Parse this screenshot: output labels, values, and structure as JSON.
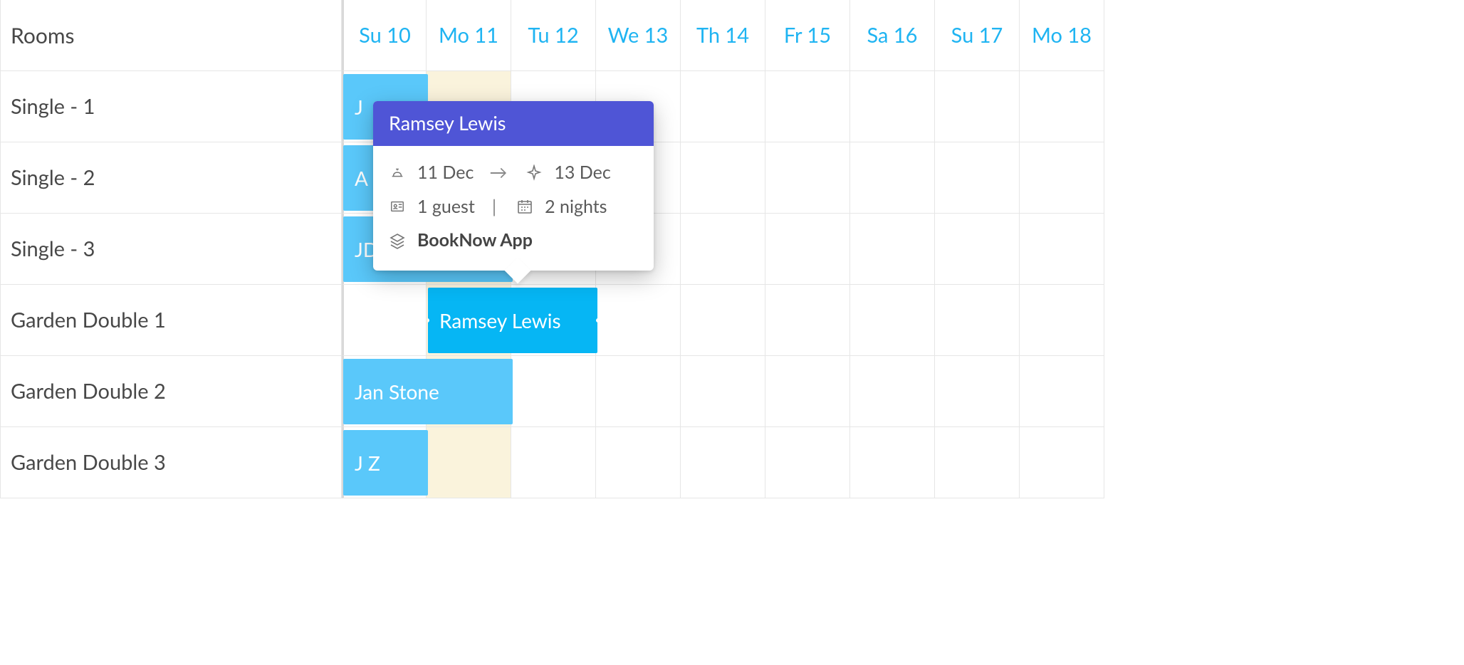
{
  "header": {
    "rooms_label": "Rooms",
    "dates": [
      "Su 10",
      "Mo 11",
      "Tu 12",
      "We 13",
      "Th 14",
      "Fr 15",
      "Sa 16",
      "Su 17",
      "Mo 18"
    ]
  },
  "rooms": [
    "Single - 1",
    "Single - 2",
    "Single - 3",
    "Garden Double 1",
    "Garden Double 2",
    "Garden Double 3"
  ],
  "today_column_index": 1,
  "bookings": [
    {
      "row": 0,
      "label": "J",
      "start_col": 0,
      "span": 1,
      "style": "light"
    },
    {
      "row": 1,
      "label": "A",
      "start_col": 0,
      "span": 1,
      "style": "light"
    },
    {
      "row": 2,
      "label": "JD",
      "start_col": 0,
      "span": 2,
      "style": "light"
    },
    {
      "row": 3,
      "label": "Ramsey Lewis",
      "start_col": 1,
      "span": 2,
      "style": "dark",
      "selected": true
    },
    {
      "row": 4,
      "label": "Jan Stone",
      "start_col": 0,
      "span": 2,
      "style": "light"
    },
    {
      "row": 5,
      "label": "J Z",
      "start_col": 0,
      "span": 1,
      "style": "light"
    }
  ],
  "popover": {
    "guest_name": "Ramsey Lewis",
    "checkin": "11 Dec",
    "checkout": "13 Dec",
    "guests": "1 guest",
    "nights": "2 nights",
    "source": "BookNow App"
  },
  "colors": {
    "accent": "#1fb4f2",
    "booking_light": "#5ac8fa",
    "booking_dark": "#06b6f4",
    "popover_header": "#4f55d6"
  }
}
